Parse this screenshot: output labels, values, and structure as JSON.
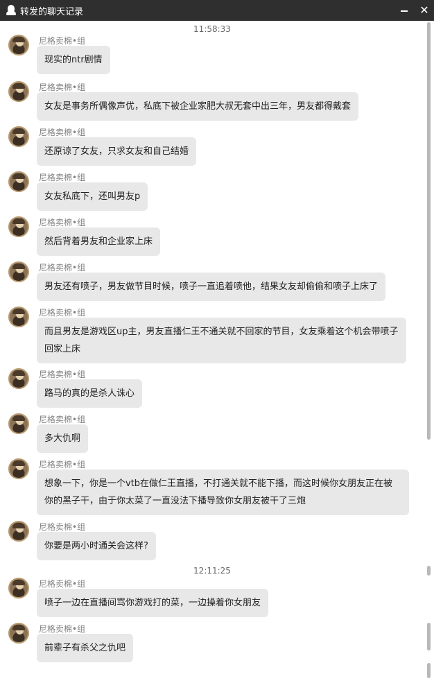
{
  "window": {
    "title": "转发的聊天记录",
    "title_icon": "qq-penguin-icon",
    "minimize_icon": "minimize-icon",
    "close_icon": "close-icon",
    "close_glyph": "✕"
  },
  "timestamps": [
    "11:58:33",
    "12:11:25"
  ],
  "sender_name": "尼格卖棉•组",
  "messages": [
    {
      "text": "现实的ntr剧情"
    },
    {
      "text": "女友是事务所偶像声优，私底下被企业家肥大叔无套中出三年，男友都得戴套"
    },
    {
      "text": "还原谅了女友，只求女友和自己结婚"
    },
    {
      "text": "女友私底下，还叫男友p"
    },
    {
      "text": "然后背着男友和企业家上床"
    },
    {
      "text": "男友还有喷子，男友做节目时候，喷子一直追着喷他，结果女友却偷偷和喷子上床了"
    },
    {
      "text": "而且男友是游戏区up主，男友直播仁王不通关就不回家的节目，女友乘着这个机会带喷子回家上床"
    },
    {
      "text": "路马的真的是杀人诛心"
    },
    {
      "text": "多大仇啊"
    },
    {
      "text": "想象一下，你是一个vtb在做仁王直播，不打通关就不能下播，而这时候你女朋友正在被你的黑子干，由于你太菜了一直没法下播导致你女朋友被干了三炮"
    },
    {
      "text": "你要是两小时通关会这样?"
    },
    {
      "text": "喷子一边在直播间骂你游戏打的菜，一边操着你女朋友"
    },
    {
      "text": "前辈子有杀父之仇吧"
    }
  ],
  "colors": {
    "titlebar": "#2f2f2f",
    "bubble": "#e8e8e8",
    "sender_text": "#808080",
    "scrollbar_thumb": "#b8b8b8"
  }
}
